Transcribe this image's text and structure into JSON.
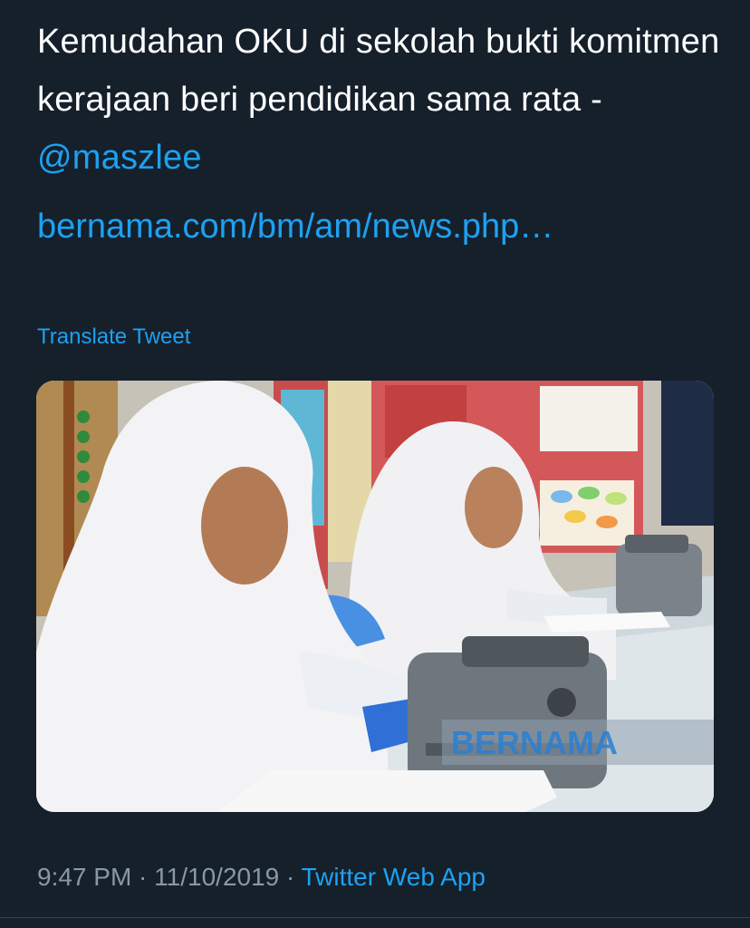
{
  "tweet": {
    "text_part1": "Kemudahan OKU di sekolah bukti komitmen kerajaan beri pendidikan sama rata - ",
    "mention": "@maszlee",
    "link": "bernama.com/bm/am/news.php…",
    "translate_label": "Translate Tweet"
  },
  "media": {
    "watermark": "BERNAMA"
  },
  "meta": {
    "time": "9:47 PM",
    "separator1": " · ",
    "date": "11/10/2019",
    "separator2": " · ",
    "source": "Twitter Web App"
  },
  "colors": {
    "background": "#15202b",
    "accent": "#1da1f2",
    "muted": "#8899a6"
  }
}
